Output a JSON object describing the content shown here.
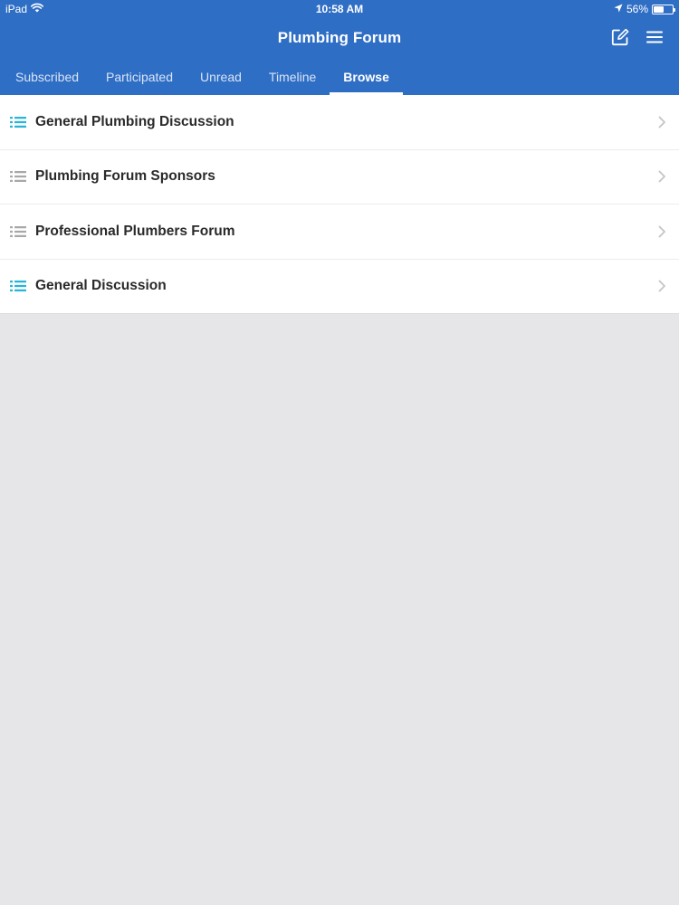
{
  "status_bar": {
    "device": "iPad",
    "time": "10:58 AM",
    "battery": "56%",
    "battery_level": 0.56
  },
  "header": {
    "title": "Plumbing Forum",
    "compose_icon": "compose-icon",
    "menu_icon": "menu-icon"
  },
  "tabs": [
    {
      "label": "Subscribed",
      "active": false
    },
    {
      "label": "Participated",
      "active": false
    },
    {
      "label": "Unread",
      "active": false
    },
    {
      "label": "Timeline",
      "active": false
    },
    {
      "label": "Browse",
      "active": true
    }
  ],
  "forums": [
    {
      "label": "General Plumbing Discussion",
      "icon_color": "#27b5d8"
    },
    {
      "label": "Plumbing Forum Sponsors",
      "icon_color": "#a8a8a8"
    },
    {
      "label": "Professional Plumbers Forum",
      "icon_color": "#a8a8a8"
    },
    {
      "label": "General Discussion",
      "icon_color": "#27b5d8"
    }
  ],
  "colors": {
    "header_bg": "#2f6ec5",
    "page_bg": "#e6e6e8",
    "chevron": "#c4c4c4"
  }
}
